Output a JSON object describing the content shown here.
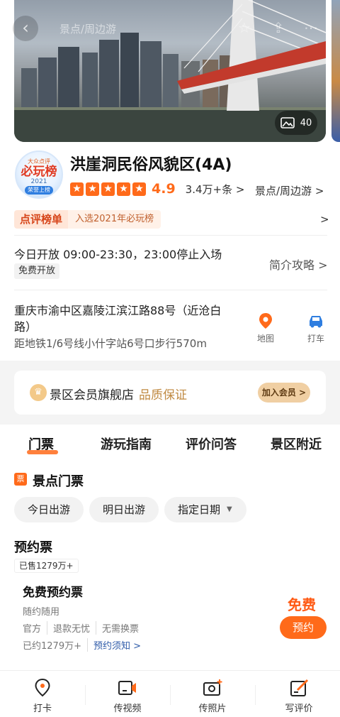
{
  "hero": {
    "nav_title": "景点/周边游",
    "photo_count": "40"
  },
  "badge": {
    "brand": "大众点评",
    "title": "必玩榜",
    "year": "2021",
    "tag": "荣誉上榜"
  },
  "poi": {
    "name": "洪崖洞民俗风貌区(4A)",
    "rating": "4.9",
    "review_count": "3.4万+条 >",
    "category": "景点/周边游 >",
    "rank_tag": "点评榜单",
    "rank_text": "入选2021年必玩榜",
    "rank_arrow": ">",
    "hours": "今日开放 09:00-23:30，23:00停止入场",
    "free_tag": "免费开放",
    "guide_link": "简介攻略 >",
    "address": "重庆市渝中区嘉陵江滨江路88号（近沧白路）",
    "metro": "距地铁1/6号线小什字站6号口步行570m",
    "map_label": "地图",
    "taxi_label": "打车"
  },
  "member": {
    "title": "景区会员旗舰店",
    "slogan": "品质保证",
    "join": "加入会员 >"
  },
  "tabs": [
    "门票",
    "游玩指南",
    "评价问答",
    "景区附近"
  ],
  "tickets": {
    "section_icon": "票",
    "section_title": "景点门票",
    "dates": [
      "今日出游",
      "明日出游",
      "指定日期"
    ],
    "type_title": "预约票",
    "sold": "已售1279万+",
    "item": {
      "name": "免费预约票",
      "sub": "随约随用",
      "tags": [
        "官方",
        "退款无忧",
        "无需换票"
      ],
      "booked": "已约1279万+",
      "notice": "预约须知 >",
      "price": "免费",
      "button": "预约"
    }
  },
  "bottom_bar": [
    "打卡",
    "传视频",
    "传照片",
    "写评价"
  ],
  "colors": {
    "accent": "#ff6a1a",
    "gold": "#c08a42",
    "link": "#2d5aa8",
    "map": "#ff6a1a",
    "taxi": "#2f7ee0"
  }
}
